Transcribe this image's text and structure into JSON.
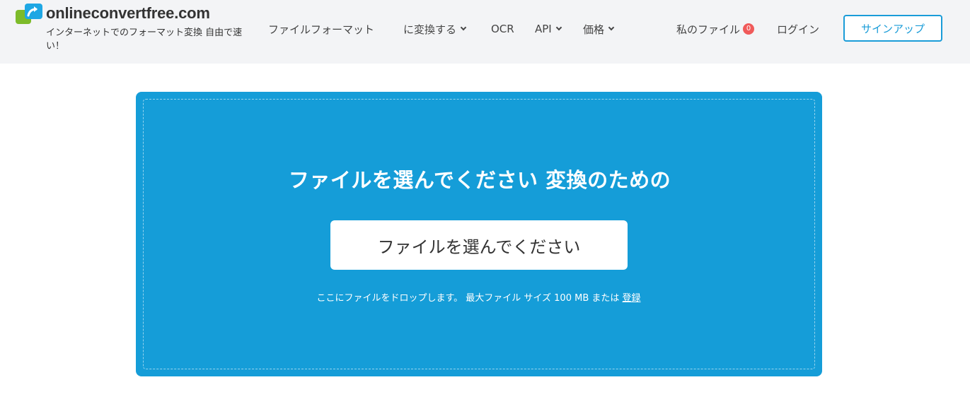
{
  "header": {
    "logo_title": "onlineconvertfree.com",
    "logo_tagline": "インターネットでのフォーマット変換 自由で速い！",
    "nav": [
      {
        "label": "ファイルフォーマット",
        "has_dropdown": false
      },
      {
        "label": "に変換する",
        "has_dropdown": true
      },
      {
        "label": "OCR",
        "has_dropdown": false
      },
      {
        "label": "API",
        "has_dropdown": true
      },
      {
        "label": "価格",
        "has_dropdown": true
      }
    ],
    "my_files_label": "私のファイル",
    "my_files_count": "0",
    "login_label": "ログイン",
    "signup_label": "サインアップ"
  },
  "upload": {
    "title": "ファイルを選んでください 変換のための",
    "choose_button": "ファイルを選んでください",
    "note_text": "ここにファイルをドロップします。 最大ファイル サイズ 100 MB または",
    "register_link": "登録"
  },
  "colors": {
    "primary": "#159dd8",
    "header_bg": "#f3f4f6",
    "badge": "#f05a5a",
    "logo_blue": "#1ea7e4",
    "logo_green": "#7dbb2a"
  },
  "icons": {
    "logo": "arrow-convert-icon",
    "dropdown": "chevron-down-icon"
  }
}
